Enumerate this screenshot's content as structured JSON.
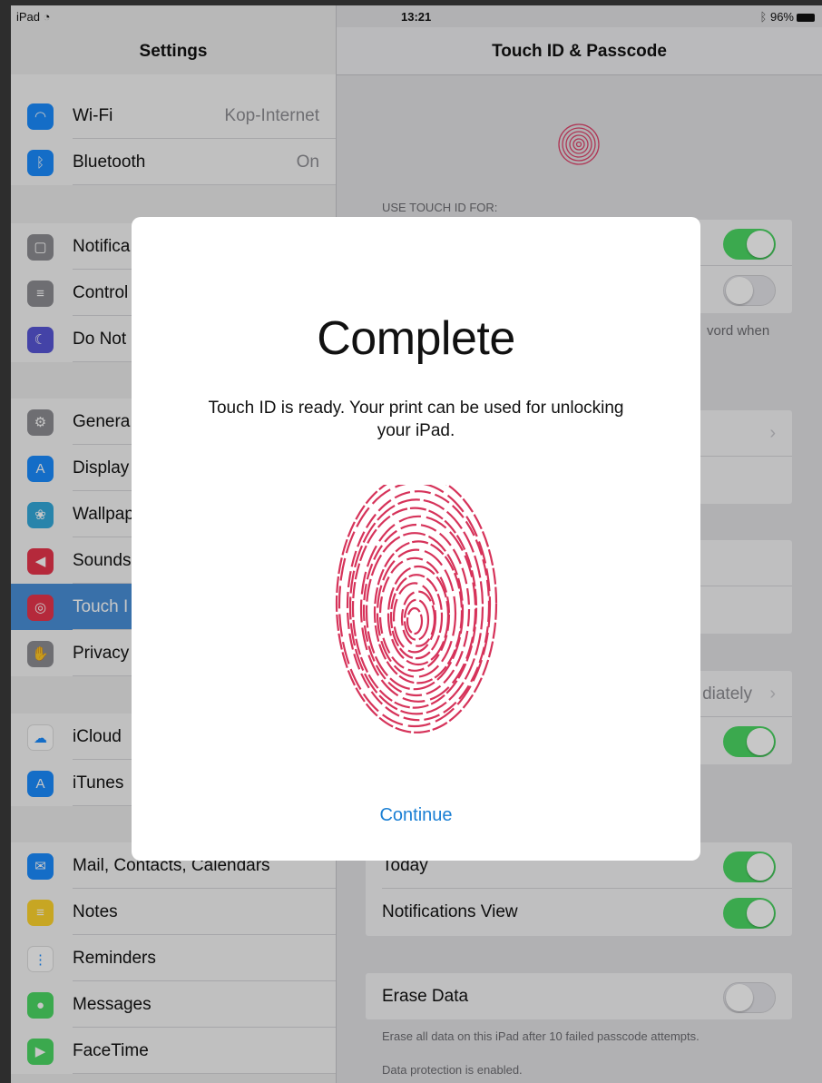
{
  "status_bar": {
    "device": "iPad",
    "wifi": "wifi-icon",
    "time": "13:21",
    "bluetooth": "bluetooth-icon",
    "battery": "96%"
  },
  "left": {
    "title": "Settings",
    "rows": [
      {
        "name": "wifi",
        "label": "Wi-Fi",
        "value": "Kop-Internet",
        "icon": "wifi-icon",
        "color": "#1a8cff"
      },
      {
        "name": "bluetooth",
        "label": "Bluetooth",
        "value": "On",
        "icon": "bluetooth-icon",
        "color": "#1a8cff"
      },
      {
        "name": "notifications",
        "label": "Notifica",
        "icon": "notifications-icon",
        "color": "#8e8e93"
      },
      {
        "name": "control-center",
        "label": "Control",
        "icon": "control-center-icon",
        "color": "#8e8e93"
      },
      {
        "name": "do-not-disturb",
        "label": "Do Not",
        "icon": "moon-icon",
        "color": "#5856d6"
      },
      {
        "name": "general",
        "label": "Genera",
        "icon": "gear-icon",
        "color": "#8e8e93"
      },
      {
        "name": "display",
        "label": "Display",
        "icon": "display-icon",
        "color": "#1a8cff"
      },
      {
        "name": "wallpaper",
        "label": "Wallpap",
        "icon": "wallpaper-icon",
        "color": "#34aadc"
      },
      {
        "name": "sounds",
        "label": "Sounds",
        "icon": "speaker-icon",
        "color": "#e8354c"
      },
      {
        "name": "touch-id",
        "label": "Touch I",
        "icon": "fingerprint-icon",
        "color": "#e8354c"
      },
      {
        "name": "privacy",
        "label": "Privacy",
        "icon": "hand-icon",
        "color": "#8e8e93"
      },
      {
        "name": "icloud",
        "label": "iCloud",
        "icon": "cloud-icon",
        "color": "#ffffff"
      },
      {
        "name": "itunes",
        "label": "iTunes",
        "icon": "app-store-icon",
        "color": "#1a8cff"
      },
      {
        "name": "mail",
        "label": "Mail, Contacts, Calendars",
        "icon": "mail-icon",
        "color": "#1a8cff"
      },
      {
        "name": "notes",
        "label": "Notes",
        "icon": "notes-icon",
        "color": "#ffd52e"
      },
      {
        "name": "reminders",
        "label": "Reminders",
        "icon": "reminders-icon",
        "color": "#ffffff"
      },
      {
        "name": "messages",
        "label": "Messages",
        "icon": "messages-icon",
        "color": "#4cd964"
      },
      {
        "name": "facetime",
        "label": "FaceTime",
        "icon": "facetime-icon",
        "color": "#4cd964"
      }
    ]
  },
  "right": {
    "title": "Touch ID & Passcode",
    "section_header": "USE TOUCH ID FOR:",
    "partial_text": "vord when",
    "partial_value": "diately",
    "today_label": "Today",
    "notifications_view_label": "Notifications View",
    "erase_data_label": "Erase Data",
    "erase_footer": "Erase all data on this iPad after 10 failed passcode attempts.",
    "protection_footer": "Data protection is enabled."
  },
  "modal": {
    "title": "Complete",
    "message": "Touch ID is ready. Your print can be used for unlocking your iPad.",
    "continue_label": "Continue",
    "fingerprint_color": "#d6335a"
  }
}
